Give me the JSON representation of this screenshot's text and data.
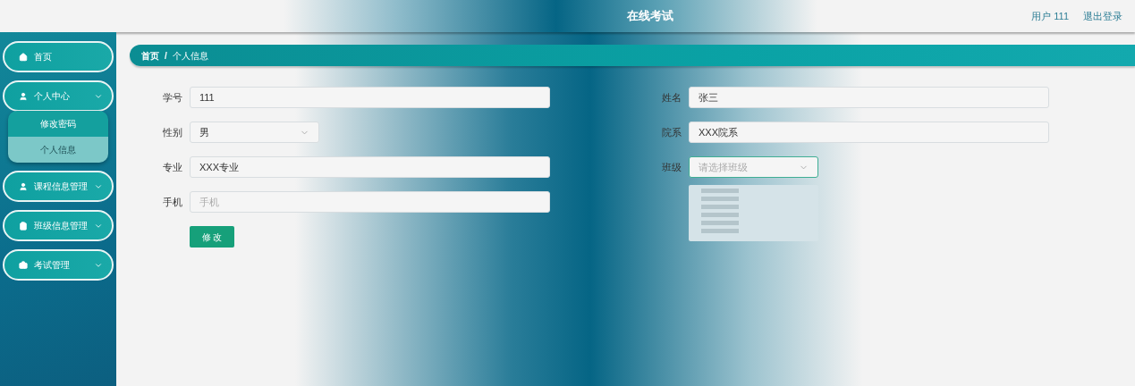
{
  "header": {
    "title": "在线考试",
    "user": "用户 111",
    "logout": "退出登录"
  },
  "sidebar": {
    "items": [
      {
        "label": "首页",
        "kind": "link"
      },
      {
        "label": "个人中心",
        "kind": "group",
        "children": [
          {
            "label": "修改密码",
            "selected": false
          },
          {
            "label": "个人信息",
            "selected": true
          }
        ]
      },
      {
        "label": "课程信息管理",
        "kind": "group"
      },
      {
        "label": "班级信息管理",
        "kind": "group"
      },
      {
        "label": "考试管理",
        "kind": "group"
      }
    ]
  },
  "breadcrumb": {
    "separator": "/",
    "items": [
      "首页",
      "个人信息"
    ]
  },
  "form": {
    "left": [
      {
        "label": "学号",
        "kind": "input",
        "value": "111"
      },
      {
        "label": "性别",
        "kind": "select",
        "value": "男"
      },
      {
        "label": "专业",
        "kind": "input",
        "value": "XXX专业"
      },
      {
        "label": "手机",
        "kind": "input",
        "placeholder": "手机"
      }
    ],
    "right": [
      {
        "label": "姓名",
        "kind": "input",
        "value": "张三"
      },
      {
        "label": "院系",
        "kind": "input",
        "value": "XXX院系"
      },
      {
        "label": "班级",
        "kind": "select",
        "placeholder": "请选择班级",
        "open": true
      }
    ],
    "submit": "修 改"
  }
}
